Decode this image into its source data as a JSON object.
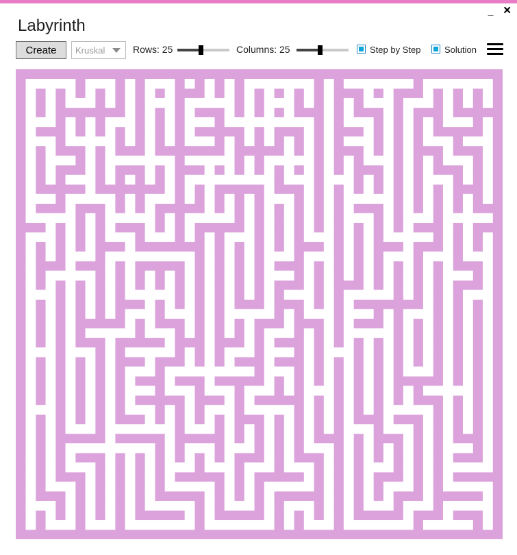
{
  "window": {
    "title": "Labyrinth",
    "accent_color": "#e97cc6",
    "controls": {
      "minimize_label": "_",
      "close_label": "✕"
    }
  },
  "toolbar": {
    "create_label": "Create",
    "algorithm_value": "Kruskal",
    "rows_label": "Rows: 25",
    "rows_value": 25,
    "rows_slider_fraction": 0.45,
    "columns_label": "Columns: 25",
    "columns_value": 25,
    "columns_slider_fraction": 0.45,
    "step_by_step_label": "Step by Step",
    "step_by_step_checked": true,
    "solution_label": "Solution",
    "solution_checked": true,
    "checkbox_color": "#0ea5d8",
    "menu_icon": "hamburger-icon"
  },
  "maze": {
    "rows": 25,
    "columns": 25,
    "wall_color": "#dba2dc",
    "passage_color": "#ffffff",
    "pattern": [
      "#################################################",
      "#.....#...#.#...#.#.#.#.......#.#.......#.......#",
      "#.#.#.#.#.#.#.#.###.#.#.#.#.#.#.###.#.###.#.#.#.#",
      "#.#.#...#.#.#...#.....#.#...#.#.#.#...#...#.#.#.#",
      "#.#.#######.#.#.#.###.#.#.#.###.#.###.#.###.#####",
      "#...#.#.#...#.#.#...#.........#.#...#.#.#.#...#.#",
      "#.###.#.#.#.#.#.#.#####.#.###.#.###.#.#.#.#####.#",
      "#...#.....#.#.#.#...#.#.#.#.#.#.#...#.#.#...#...#",
      "#.#.###.#.###.#######.#####.#.#.###.#.#.###.###.#",
      "#.#...#.#.......#.....#.#.....#.#.#...#.#.#...#.#",
      "#.#.###.#.###.#.###.#.#.#.#.#.#.#.###.#.#.###.#.#",
      "#.#.#...#.#.#.#.#.........#...#...#.#.#.#...#.#.#",
      "#.#####.#######.#.#.#####.###.#.#.#.#.#.#.#.###.#",
      "#...#.....#.#...#.#.#.#.#...#.#.#.....#.#.#.#.#.#",
      "#.###.###.#.#.#####.#.#.#.#.#.#.#.###.#.#.#.#.###",
      "#.....#.#.....#.#.....#.#.#.#.#.#...#.#...#.....#",
      "###.#.#.#.###.#.#.#####.#.#.#.#.#.#.#.#.###.#.###",
      "#...#.#.#...#...#.#.#...#.#.#...#.#.#.....#.#.#.#",
      "#.#.#.#.###.#######.#.#.#.#.###.#.#.###.###.#.#.#",
      "#.#.#...#.........#.#.#.#...#...#.#.#...#...#...#",
      "#.###.###.#.#####.#.#.#.#.###.#.#.#.#.#.#.#.###.#",
      "#.#.....#.#.#.#.#.#.#.#.#...#.#.#.#.#.#.#.#...#.#",
      "#.#.#.#.#.#.#.#.#.#.#.#.#.###.#.###.#.#.#.#.###.#",
      "#...#.#.#.#.....#.#.#.#.#.#...#.#.....#.#.#.#...#",
      "#.#.#.#.#.###.#.#.#.#.###.###.#.#.#######.#.#.#.#",
      "#.#.#.#.#.#...#...#.#.....#.#...#...#.#...#.#.#.#",
      "#.#.#.#####.#.###.#.#.#.###.###.#.###.#.#.#.#.#.#",
      "#.#.#.#.....#...#.#.#.#.#...#.#.#.....#.#.#.#.#.#",
      "#.#.#.###.#####.###.###.#.###.#.#.#.#.#.#.#.#.#.#",
      "#...#...#.#.....#.#.#...#...#.#...#.#.#.#.#.#.#.#",
      "#.#.#.#.#.###.###.#.#.###.###.#.#.#.#.#.#.#.#.#.#",
      "#.#.#.#.#.#...#.........#...#.#.#.#.#.#...#.#.#.#",
      "#.#.#.#.#.#.###.###.#####.#.#.#.#.#.#.#####.#.#.#",
      "#.#.#.#.#.#...#...#...#...#.#...#.#.#.#.#.....#.#",
      "#.#.#.#.#.#.#####.###.#.#####.#.#.#.#.#.###.#.#.#",
      "#...#.#.#.#...#.#.#...#.....#.#.#.#.#.....#.#.#.#",
      "#.#.#.#.#.###.#.#.#.#.###.#.#.#.#.###.###.#.#.#.#",
      "#.#.#...#.......#...#.#.#.#.#.#.#...#...#.#.#.#.#",
      "#.#.#####.#####.#####.#.#.#.#.###.#.###.#.#.###.#",
      "#.#.#.........#.#...#...#.#.#...#.#.#.#.#.#...#.#",
      "#.#.#.###.#.#.#.#.#.#.###.#.###.#.#.#.#.#.#.###.#",
      "#.#.#...#.#.#.#...#...#...#...#.#.#...#.#.#.....#",
      "#.#.###.#.#.#.#.#####.#.#####.#.#.#.###.#.#.#####",
      "#.#...#.#.#.#.#.....#.#.#.....#.#.#.#...#.#.....#",
      "#.###.#.#.#.#.#####.#.#.#.#####.#.#.#.###.#####.#",
      "#...#.#.#.#.#.....#.#...#.#...#.#.#...#...#.....#",
      "#.#.#.#.#.#.#####.#.#####.#.#.#.#.#####.###.###.#",
      "#.#...#...#.......#.......#.#...#.......#.....#.#",
      "#################################################"
    ]
  }
}
